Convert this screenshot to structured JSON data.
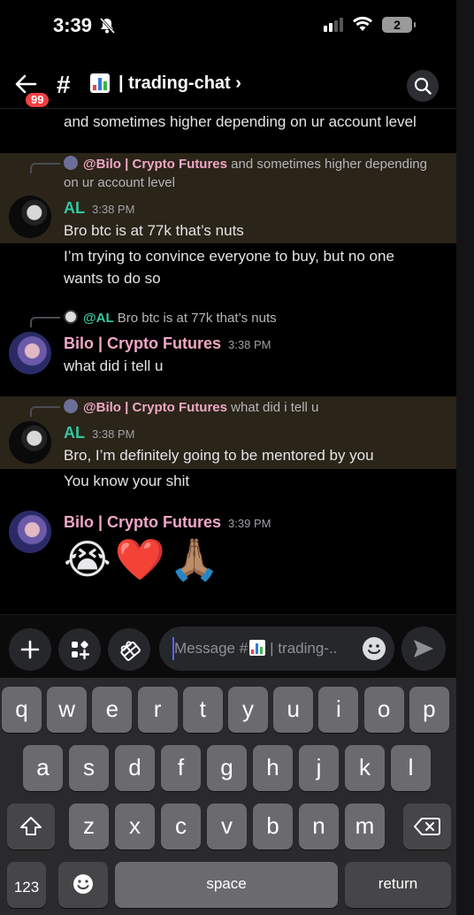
{
  "status_bar": {
    "time": "3:39",
    "battery": "2"
  },
  "header": {
    "unread_badge": "99",
    "hash": "#",
    "channel_name": "| trading-chat",
    "chevron": "›"
  },
  "messages": {
    "prev_tail": "and sometimes higher depending on ur account level",
    "m1": {
      "reply_author": "@Bilo | Crypto Futures",
      "reply_text_1": "and sometimes higher depending",
      "reply_text_2": "on ur account level",
      "author": "AL",
      "time": "3:38 PM",
      "line1": "Bro btc is at 77k that’s nuts",
      "line2": "I’m trying to convince everyone to buy, but no one",
      "line3": "wants  to do so"
    },
    "m2": {
      "reply_author": "@AL",
      "reply_text": "Bro btc is at 77k that’s nuts",
      "author": "Bilo | Crypto Futures",
      "time": "3:38 PM",
      "line1": "what did i tell u"
    },
    "m3": {
      "reply_author": "@Bilo | Crypto Futures",
      "reply_text": "what did i tell u",
      "author": "AL",
      "time": "3:38 PM",
      "line1": "Bro, I’m definitely going to be mentored by you",
      "line2": "You know your shit"
    },
    "m4": {
      "author": "Bilo | Crypto Futures",
      "time": "3:39 PM",
      "emojis": "😭❤️🙏🏽"
    }
  },
  "composer": {
    "placeholder_prefix": "Message #",
    "placeholder_suffix": "| trading-.."
  },
  "keyboard": {
    "row1": [
      "q",
      "w",
      "e",
      "r",
      "t",
      "y",
      "u",
      "i",
      "o",
      "p"
    ],
    "row2": [
      "a",
      "s",
      "d",
      "f",
      "g",
      "h",
      "j",
      "k",
      "l"
    ],
    "row3": [
      "z",
      "x",
      "c",
      "v",
      "b",
      "n",
      "m"
    ],
    "numbers_key": "123",
    "space_key": "space",
    "return_key": "return"
  },
  "colors": {
    "background": "#000000",
    "highlight": "#2a2419",
    "al_name": "#35c7a0",
    "bilo_name": "#f0a7c4",
    "unread_badge": "#f23f43",
    "key": "#6b6b6f"
  },
  "icons": [
    "bell-slash-icon",
    "signal-icon",
    "wifi-icon",
    "battery-icon",
    "back-arrow-icon",
    "chart-emoji-icon",
    "search-icon",
    "plus-icon",
    "apps-icon",
    "gift-icon",
    "emoji-icon",
    "send-icon",
    "shift-icon",
    "backspace-icon",
    "keyboard-emoji-icon"
  ]
}
